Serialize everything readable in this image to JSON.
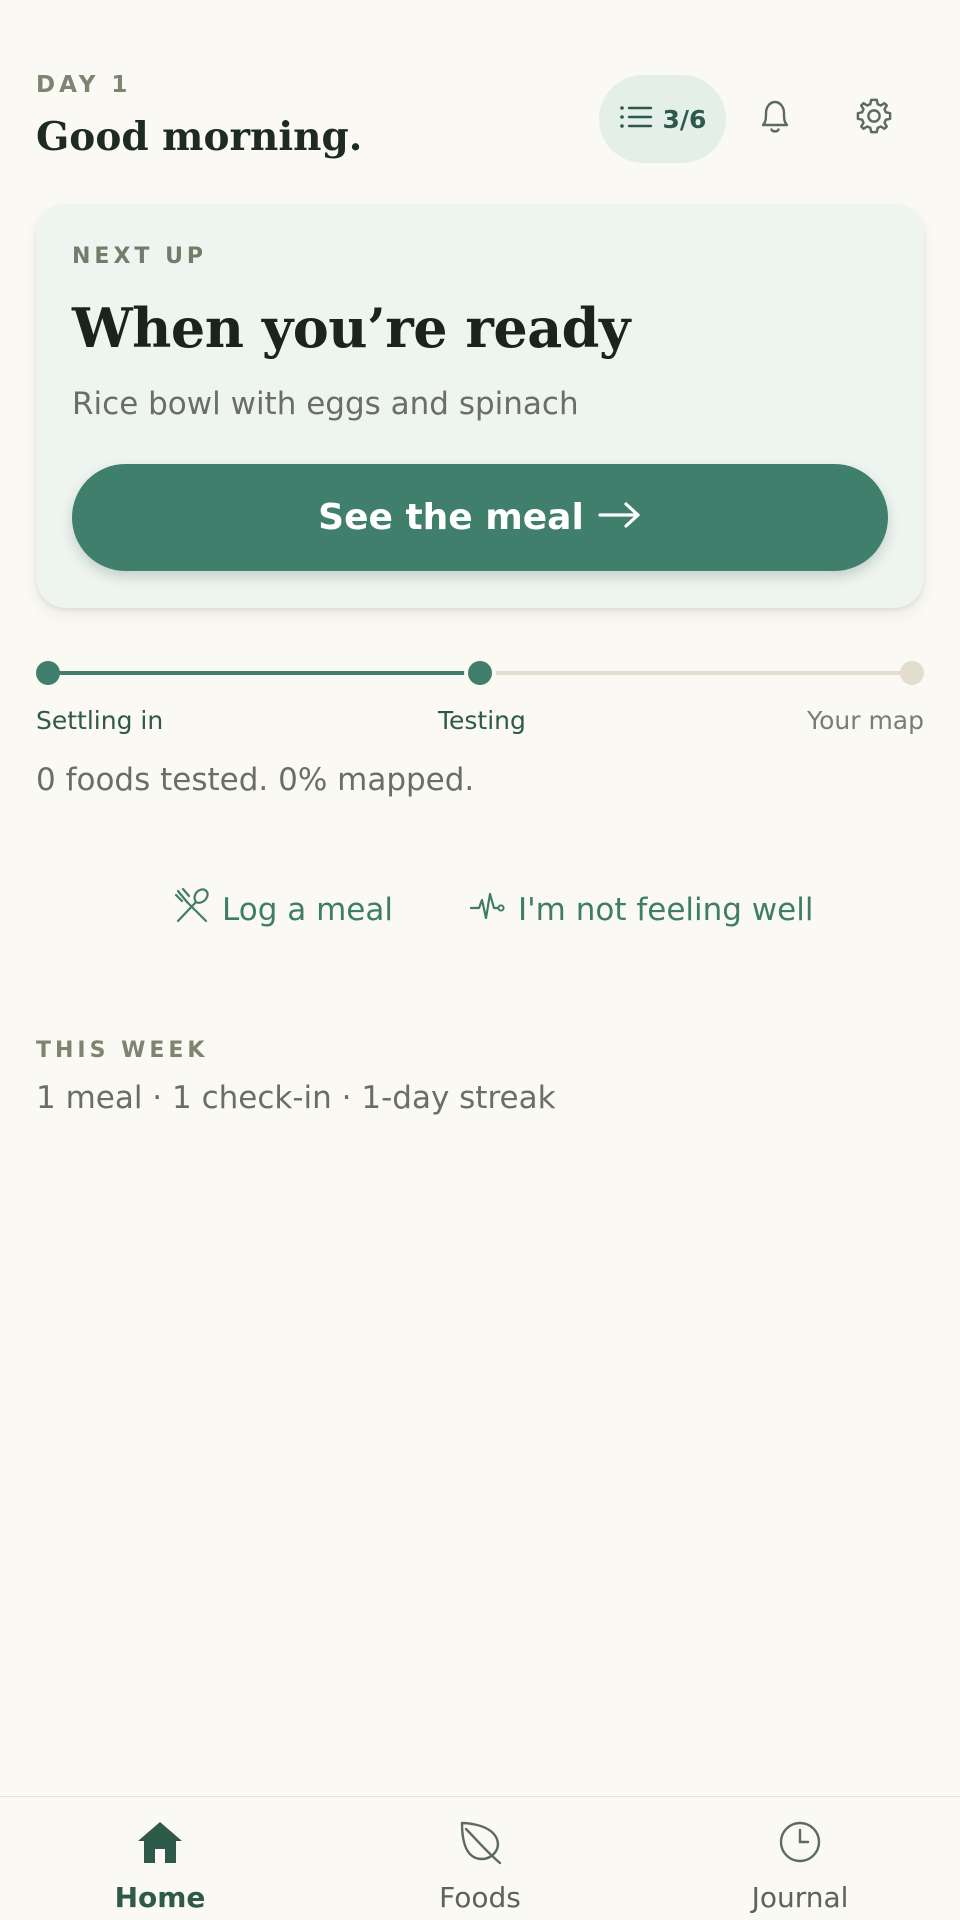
{
  "header": {
    "day_label": "DAY 1",
    "greeting": "Good morning.",
    "progress_count": "3/6",
    "icons": [
      "list-icon",
      "bell-icon",
      "gear-icon"
    ]
  },
  "next_up": {
    "eyebrow": "NEXT UP",
    "title": "When you’re ready",
    "subtitle": "Rice bowl with eggs and spinach",
    "cta_label": "See the meal",
    "cta_icon": "arrow-right-icon"
  },
  "journey": {
    "stages": [
      "Settling in",
      "Testing",
      "Your map"
    ],
    "current_stage_index": 1,
    "stats": "0 foods tested. 0% mapped."
  },
  "quick_actions": [
    {
      "label": "Log a meal",
      "icon": "utensils-icon"
    },
    {
      "label": "I'm not feeling well",
      "icon": "pulse-icon"
    }
  ],
  "this_week": {
    "label": "THIS WEEK",
    "summary": "1 meal · 1 check-in · 1-day streak"
  },
  "nav": {
    "items": [
      {
        "label": "Home",
        "icon": "home-icon",
        "active": true
      },
      {
        "label": "Foods",
        "icon": "leaf-icon",
        "active": false
      },
      {
        "label": "Journal",
        "icon": "clock-icon",
        "active": false
      }
    ]
  },
  "colors": {
    "background": "#fbf9f3",
    "accent": "#417f6d",
    "accent_dark": "#2f5a4b",
    "card": "#eef4ef",
    "track_inactive": "#e3ddd0",
    "muted_text": "#6b6e68"
  }
}
